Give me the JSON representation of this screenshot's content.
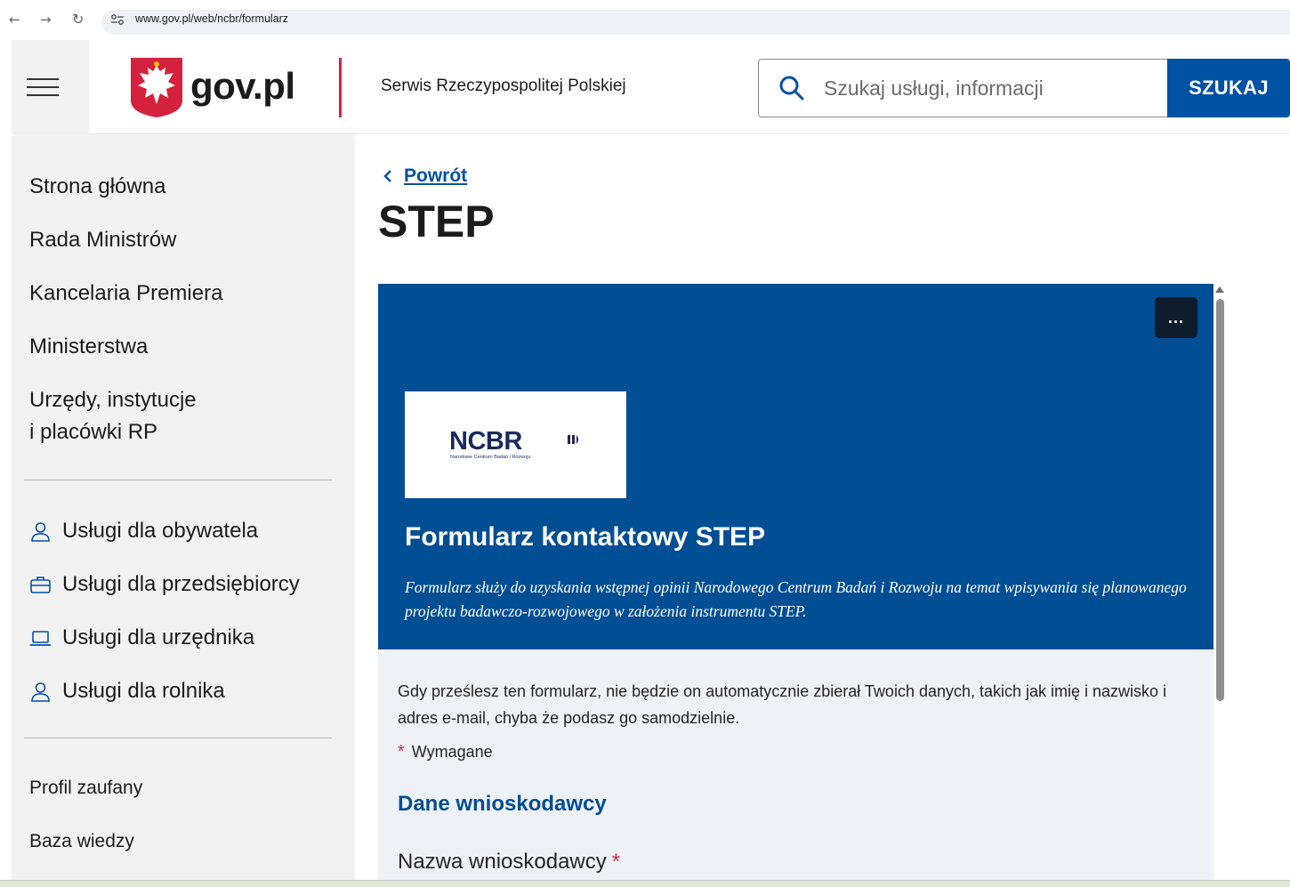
{
  "browser": {
    "url": "www.gov.pl/web/ncbr/formularz",
    "back_icon": "arrow-left-icon",
    "forward_icon": "arrow-right-icon",
    "reload_icon": "reload-icon"
  },
  "header": {
    "logo_text": "gov.pl",
    "service_name": "Serwis Rzeczypospolitej Polskiej",
    "search_placeholder": "Szukaj usługi, informacji",
    "search_button": "SZUKAJ",
    "colors": {
      "accent": "#0052a5",
      "divider": "#d4213d"
    }
  },
  "sidebar": {
    "links": [
      {
        "label": "Strona główna"
      },
      {
        "label": "Rada Ministrów"
      },
      {
        "label": "Kancelaria Premiera"
      },
      {
        "label": "Ministerstwa"
      },
      {
        "label": "Urzędy, instytucje"
      },
      {
        "label": "i placówki RP"
      }
    ],
    "services": [
      {
        "label": "Usługi dla obywatela",
        "icon": "person-icon"
      },
      {
        "label": "Usługi dla przedsiębiorcy",
        "icon": "briefcase-icon"
      },
      {
        "label": "Usługi dla urzędnika",
        "icon": "laptop-icon"
      },
      {
        "label": "Usługi dla rolnika",
        "icon": "person-icon"
      }
    ],
    "bottom_links": [
      {
        "label": "Profil zaufany"
      },
      {
        "label": "Baza wiedzy"
      }
    ]
  },
  "main": {
    "back_label": "Powrót",
    "page_title": "STEP",
    "form": {
      "more_label": "...",
      "logo": {
        "name": "NCBR",
        "subtitle": "Narodowe Centrum Badań i Rozwoju"
      },
      "title": "Formularz kontaktowy STEP",
      "description": "Formularz służy do uzyskania wstępnej opinii Narodowego Centrum Badań i Rozwoju na temat wpisywania się planowanego projektu badawczo-rozwojowego w założenia instrumentu STEP.",
      "notice": "Gdy prześlesz ten formularz, nie będzie on automatycznie zbierał Twoich danych, takich jak imię i nazwisko i adres e-mail, chyba że podasz go samodzielnie.",
      "required_star": "*",
      "required_label": "Wymagane",
      "section_title": "Dane wnioskodawcy",
      "field_label": "Nazwa wnioskodawcy",
      "colors": {
        "banner": "#004e94",
        "body": "#eef1f6"
      }
    }
  }
}
